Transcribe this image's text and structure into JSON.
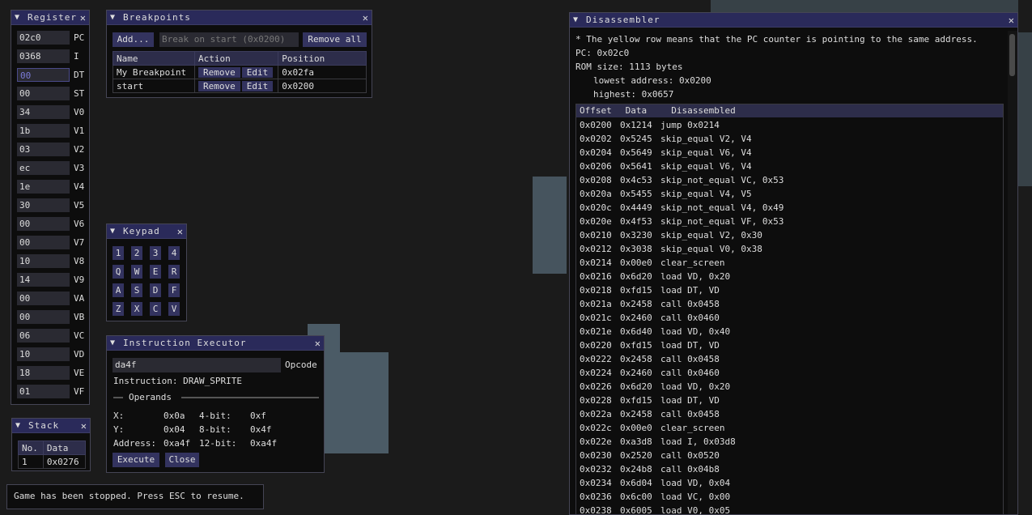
{
  "registers": {
    "title": "Registers",
    "items": [
      {
        "value": "02c0",
        "name": "PC"
      },
      {
        "value": "0368",
        "name": "I"
      },
      {
        "value": "00",
        "name": "DT"
      },
      {
        "value": "00",
        "name": "ST"
      },
      {
        "value": "34",
        "name": "V0"
      },
      {
        "value": "1b",
        "name": "V1"
      },
      {
        "value": "03",
        "name": "V2"
      },
      {
        "value": "ec",
        "name": "V3"
      },
      {
        "value": "1e",
        "name": "V4"
      },
      {
        "value": "30",
        "name": "V5"
      },
      {
        "value": "00",
        "name": "V6"
      },
      {
        "value": "00",
        "name": "V7"
      },
      {
        "value": "10",
        "name": "V8"
      },
      {
        "value": "14",
        "name": "V9"
      },
      {
        "value": "00",
        "name": "VA"
      },
      {
        "value": "00",
        "name": "VB"
      },
      {
        "value": "06",
        "name": "VC"
      },
      {
        "value": "10",
        "name": "VD"
      },
      {
        "value": "18",
        "name": "VE"
      },
      {
        "value": "01",
        "name": "VF"
      }
    ]
  },
  "breakpoints": {
    "title": "Breakpoints",
    "add_label": "Add...",
    "input_placeholder": "Break on start (0x0200)",
    "remove_all_label": "Remove all",
    "columns": [
      "Name",
      "Action",
      "Position"
    ],
    "remove_label": "Remove",
    "edit_label": "Edit",
    "rows": [
      {
        "name": "My Breakpoint",
        "position": "0x02fa"
      },
      {
        "name": "start",
        "position": "0x0200"
      }
    ]
  },
  "keypad": {
    "title": "Keypad",
    "keys": [
      "1",
      "2",
      "3",
      "4",
      "Q",
      "W",
      "E",
      "R",
      "A",
      "S",
      "D",
      "F",
      "Z",
      "X",
      "C",
      "V"
    ]
  },
  "executor": {
    "title": "Instruction Executor",
    "opcode_value": "da4f",
    "opcode_label": "Opcode",
    "instruction_text": "Instruction: DRAW_SPRITE",
    "operands_label": "Operands",
    "x_label": "X:",
    "x_value": "0x0a",
    "bit4_label": "4-bit:",
    "bit4_value": "0xf",
    "y_label": "Y:",
    "y_value": "0x04",
    "bit8_label": "8-bit:",
    "bit8_value": "0x4f",
    "address_label": "Address:",
    "address_value": "0xa4f",
    "bit12_label": "12-bit:",
    "bit12_value": "0xa4f",
    "execute_label": "Execute",
    "close_label": "Close"
  },
  "stack": {
    "title": "Stack",
    "columns": [
      "No.",
      "Data"
    ],
    "rows": [
      {
        "no": "1",
        "data": "0x0276"
      }
    ]
  },
  "status": {
    "message": "Game has been stopped. Press ESC to resume."
  },
  "disassembler": {
    "title": "Disassembler",
    "note": "* The yellow row means that the PC counter is pointing to the same address.",
    "pc": "PC: 0x02c0",
    "rom_size": "ROM size: 1113 bytes",
    "lowest": "lowest address: 0x0200",
    "highest": "highest: 0x0657",
    "columns": [
      "Offset",
      "Data",
      "Disassembled"
    ],
    "rows": [
      {
        "offset": "0x0200",
        "data": "0x1214",
        "asm": "jump 0x0214"
      },
      {
        "offset": "0x0202",
        "data": "0x5245",
        "asm": "skip_equal V2, V4"
      },
      {
        "offset": "0x0204",
        "data": "0x5649",
        "asm": "skip_equal V6, V4"
      },
      {
        "offset": "0x0206",
        "data": "0x5641",
        "asm": "skip_equal V6, V4"
      },
      {
        "offset": "0x0208",
        "data": "0x4c53",
        "asm": "skip_not_equal VC, 0x53"
      },
      {
        "offset": "0x020a",
        "data": "0x5455",
        "asm": "skip_equal V4, V5"
      },
      {
        "offset": "0x020c",
        "data": "0x4449",
        "asm": "skip_not_equal V4, 0x49"
      },
      {
        "offset": "0x020e",
        "data": "0x4f53",
        "asm": "skip_not_equal VF, 0x53"
      },
      {
        "offset": "0x0210",
        "data": "0x3230",
        "asm": "skip_equal V2, 0x30"
      },
      {
        "offset": "0x0212",
        "data": "0x3038",
        "asm": "skip_equal V0, 0x38"
      },
      {
        "offset": "0x0214",
        "data": "0x00e0",
        "asm": "clear_screen"
      },
      {
        "offset": "0x0216",
        "data": "0x6d20",
        "asm": "load VD, 0x20"
      },
      {
        "offset": "0x0218",
        "data": "0xfd15",
        "asm": "load DT, VD"
      },
      {
        "offset": "0x021a",
        "data": "0x2458",
        "asm": "call 0x0458"
      },
      {
        "offset": "0x021c",
        "data": "0x2460",
        "asm": "call 0x0460"
      },
      {
        "offset": "0x021e",
        "data": "0x6d40",
        "asm": "load VD, 0x40"
      },
      {
        "offset": "0x0220",
        "data": "0xfd15",
        "asm": "load DT, VD"
      },
      {
        "offset": "0x0222",
        "data": "0x2458",
        "asm": "call 0x0458"
      },
      {
        "offset": "0x0224",
        "data": "0x2460",
        "asm": "call 0x0460"
      },
      {
        "offset": "0x0226",
        "data": "0x6d20",
        "asm": "load VD, 0x20"
      },
      {
        "offset": "0x0228",
        "data": "0xfd15",
        "asm": "load DT, VD"
      },
      {
        "offset": "0x022a",
        "data": "0x2458",
        "asm": "call 0x0458"
      },
      {
        "offset": "0x022c",
        "data": "0x00e0",
        "asm": "clear_screen"
      },
      {
        "offset": "0x022e",
        "data": "0xa3d8",
        "asm": "load I, 0x03d8"
      },
      {
        "offset": "0x0230",
        "data": "0x2520",
        "asm": "call 0x0520"
      },
      {
        "offset": "0x0232",
        "data": "0x24b8",
        "asm": "call 0x04b8"
      },
      {
        "offset": "0x0234",
        "data": "0x6d04",
        "asm": "load VD, 0x04"
      },
      {
        "offset": "0x0236",
        "data": "0x6c00",
        "asm": "load VC, 0x00"
      },
      {
        "offset": "0x0238",
        "data": "0x6005",
        "asm": "load V0, 0x05"
      }
    ]
  }
}
